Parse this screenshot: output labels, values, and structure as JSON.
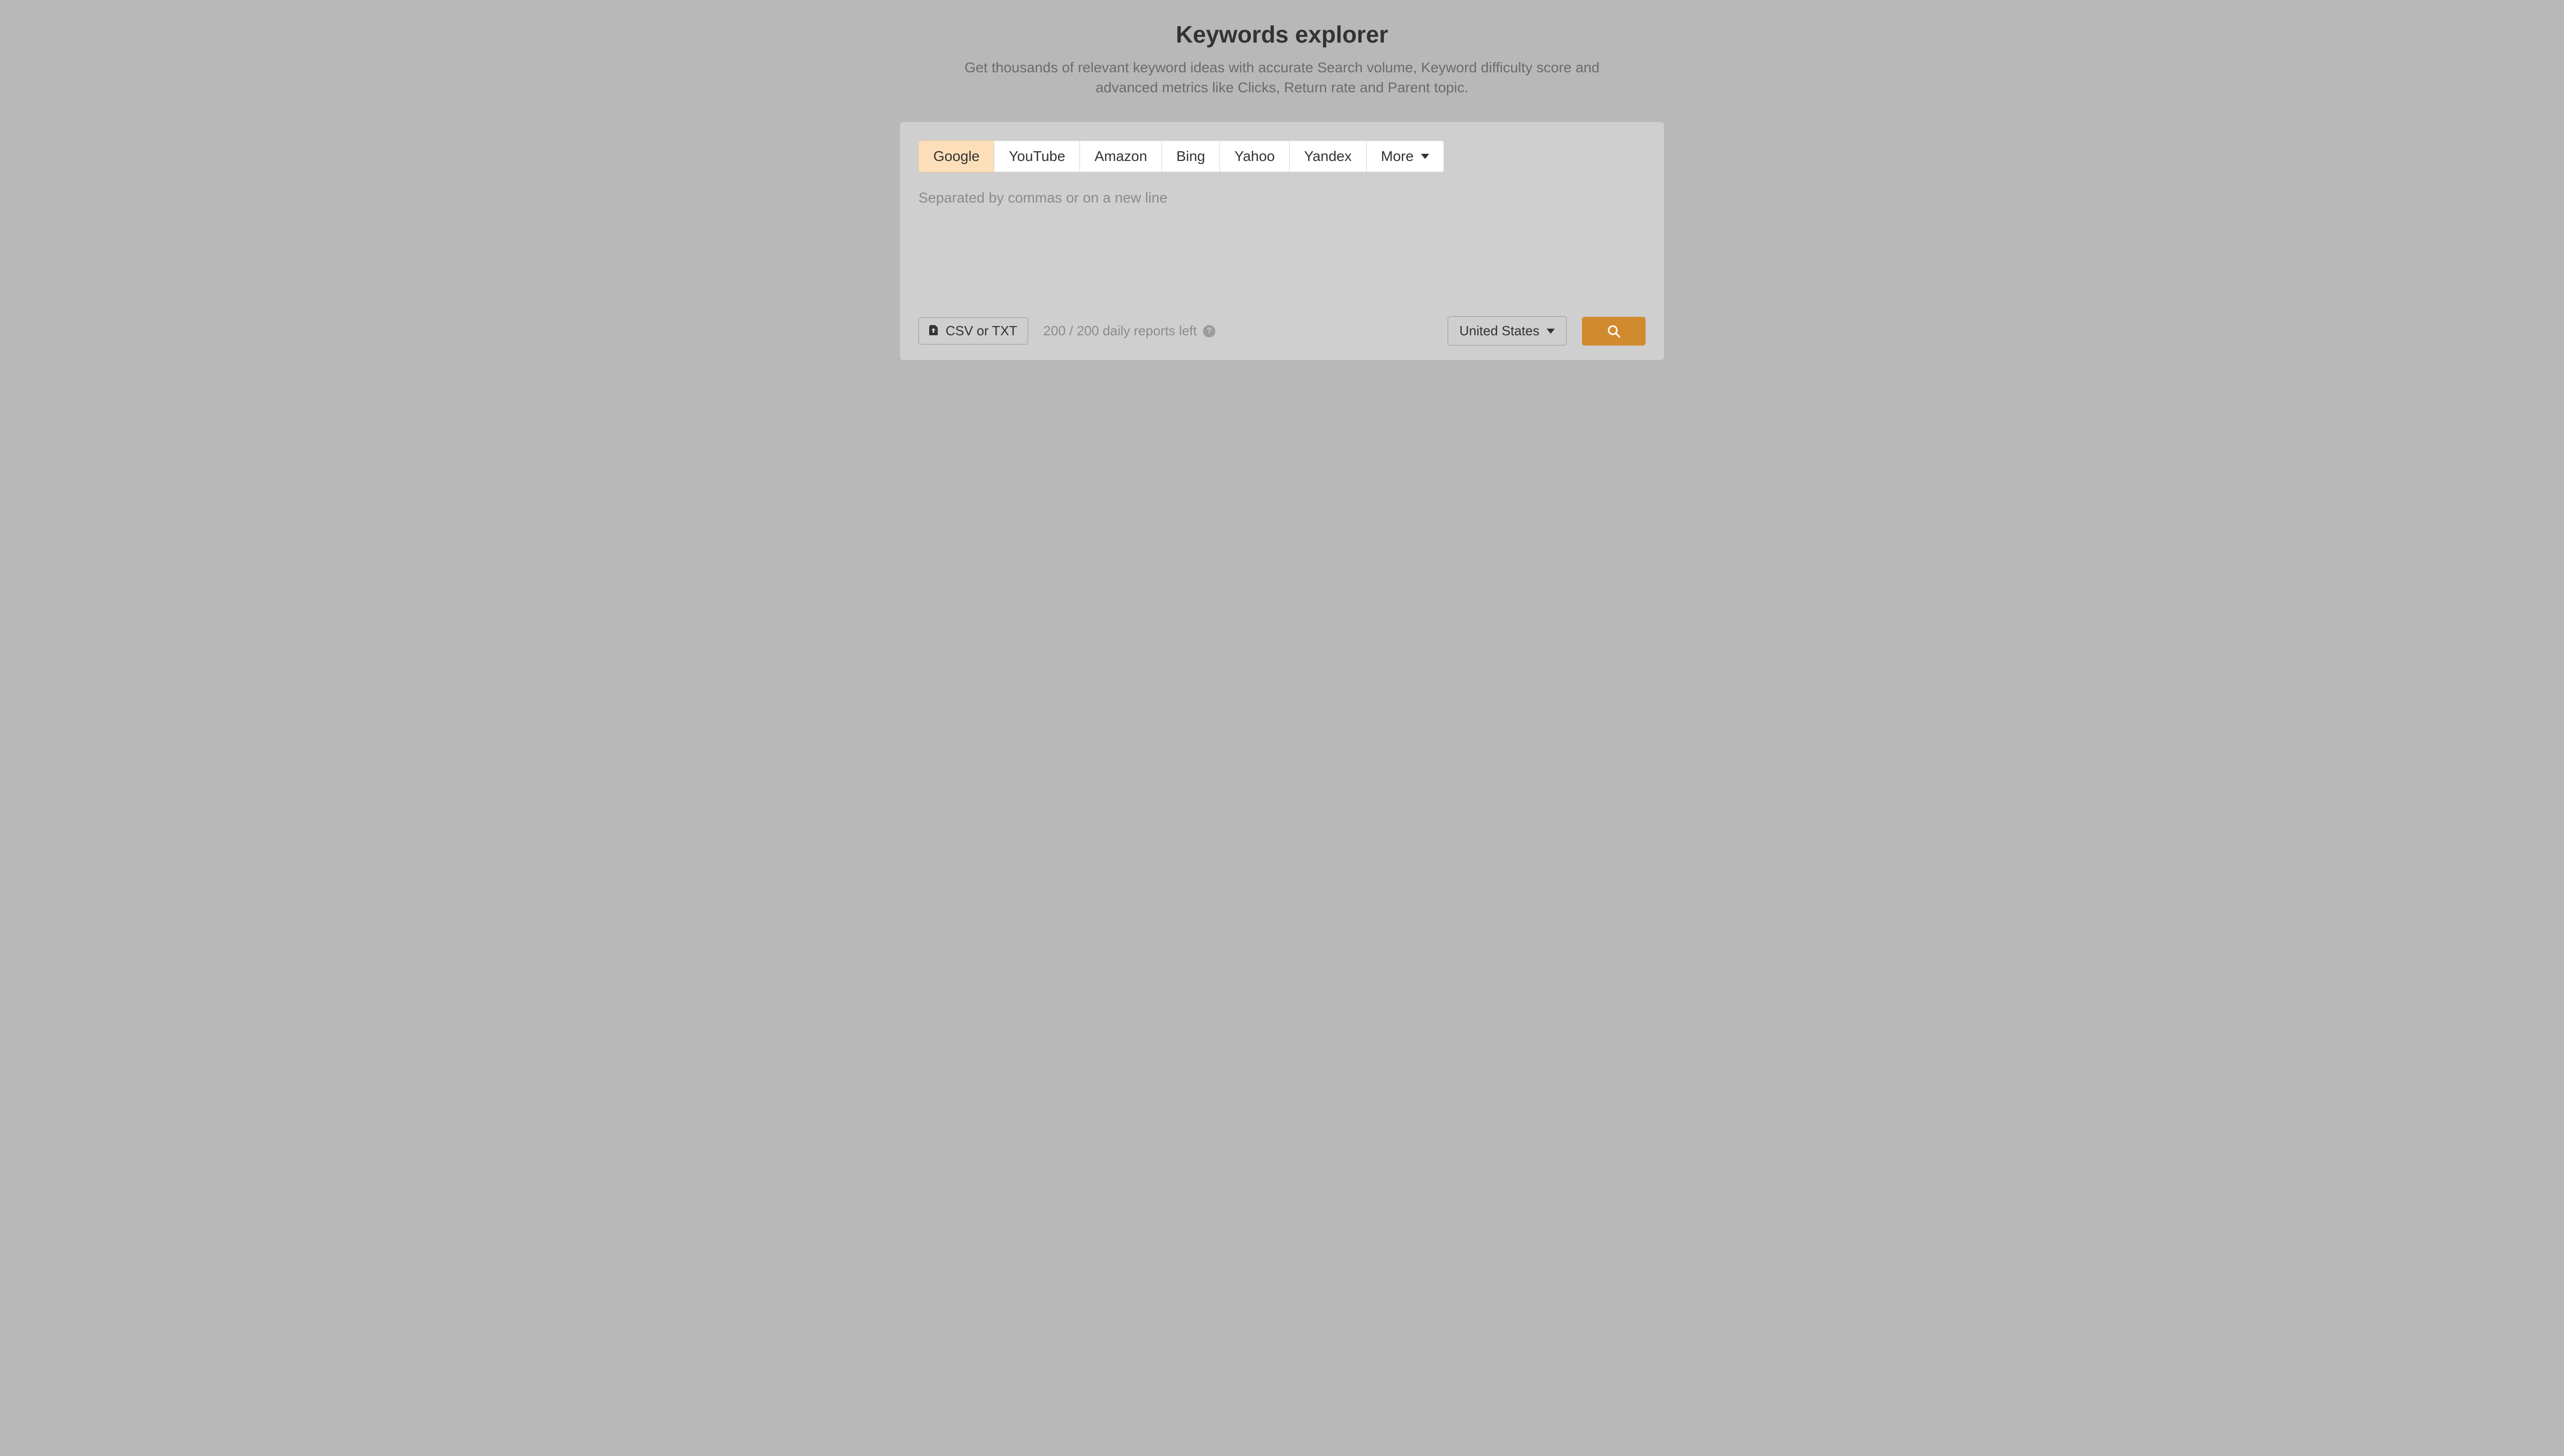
{
  "header": {
    "title": "Keywords explorer",
    "subtitle": "Get thousands of relevant keyword ideas with accurate Search volume, Keyword difficulty score and advanced metrics like Clicks, Return rate and Parent topic."
  },
  "tabs": {
    "items": [
      {
        "label": "Google",
        "active": true
      },
      {
        "label": "YouTube",
        "active": false
      },
      {
        "label": "Amazon",
        "active": false
      },
      {
        "label": "Bing",
        "active": false
      },
      {
        "label": "Yahoo",
        "active": false
      },
      {
        "label": "Yandex",
        "active": false
      }
    ],
    "more_label": "More"
  },
  "input": {
    "placeholder": "Separated by commas or on a new line",
    "value": ""
  },
  "footer": {
    "upload_label": "CSV or TXT",
    "reports_left": "200 / 200 daily reports left",
    "country_selected": "United States"
  },
  "icons": {
    "upload": "upload-icon",
    "help": "question-circle-icon",
    "caret": "chevron-down-icon",
    "search": "search-icon"
  }
}
